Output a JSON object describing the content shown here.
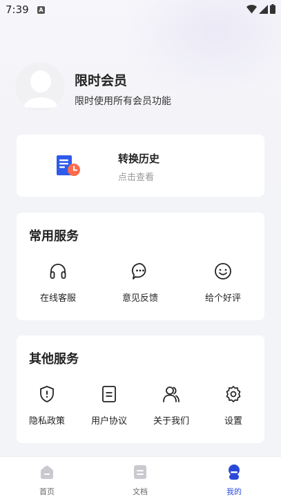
{
  "status_bar": {
    "time": "7:39",
    "notif_badge": "A"
  },
  "profile": {
    "title": "限时会员",
    "subtitle": "限时使用所有会员功能"
  },
  "history": {
    "title": "转换历史",
    "subtitle": "点击查看"
  },
  "common_services": {
    "title": "常用服务",
    "items": [
      {
        "label": "在线客服",
        "icon": "headset-icon"
      },
      {
        "label": "意见反馈",
        "icon": "chat-bubble-icon"
      },
      {
        "label": "给个好评",
        "icon": "smiley-icon"
      }
    ]
  },
  "other_services": {
    "title": "其他服务",
    "items": [
      {
        "label": "隐私政策",
        "icon": "shield-icon"
      },
      {
        "label": "用户协议",
        "icon": "document-icon"
      },
      {
        "label": "关于我们",
        "icon": "users-icon"
      },
      {
        "label": "设置",
        "icon": "gear-icon"
      }
    ]
  },
  "tabs": [
    {
      "label": "首页",
      "icon": "home-icon"
    },
    {
      "label": "文档",
      "icon": "document-tab-icon"
    },
    {
      "label": "我的",
      "icon": "profile-tab-icon",
      "active": true
    }
  ],
  "colors": {
    "accent": "#2b49d8",
    "history_icon_blue": "#2f5bea",
    "history_icon_orange": "#ff6b4a"
  }
}
